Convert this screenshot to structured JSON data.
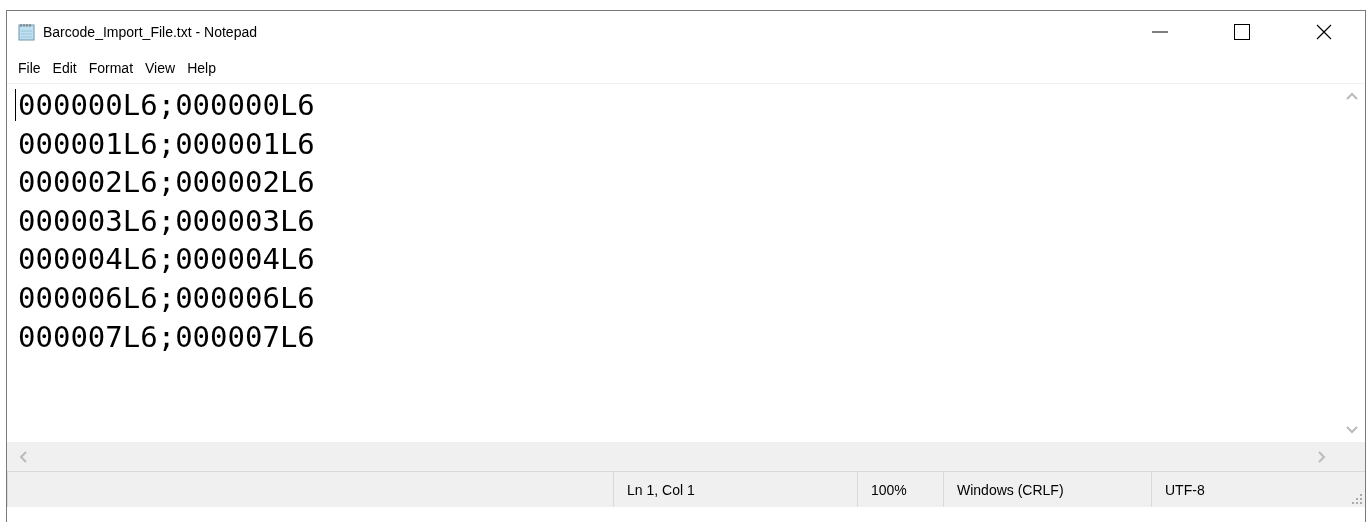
{
  "window": {
    "title": "Barcode_Import_File.txt - Notepad"
  },
  "menu": [
    "File",
    "Edit",
    "Format",
    "View",
    "Help"
  ],
  "editor": {
    "lines": [
      "000000L6;000000L6",
      "000001L6;000001L6",
      "000002L6;000002L6",
      "000003L6;000003L6",
      "000004L6;000004L6",
      "000006L6;000006L6",
      "000007L6;000007L6"
    ]
  },
  "status_bar": {
    "position": "Ln 1, Col 1",
    "zoom": "100%",
    "line_ending": "Windows (CRLF)",
    "encoding": "UTF-8"
  }
}
